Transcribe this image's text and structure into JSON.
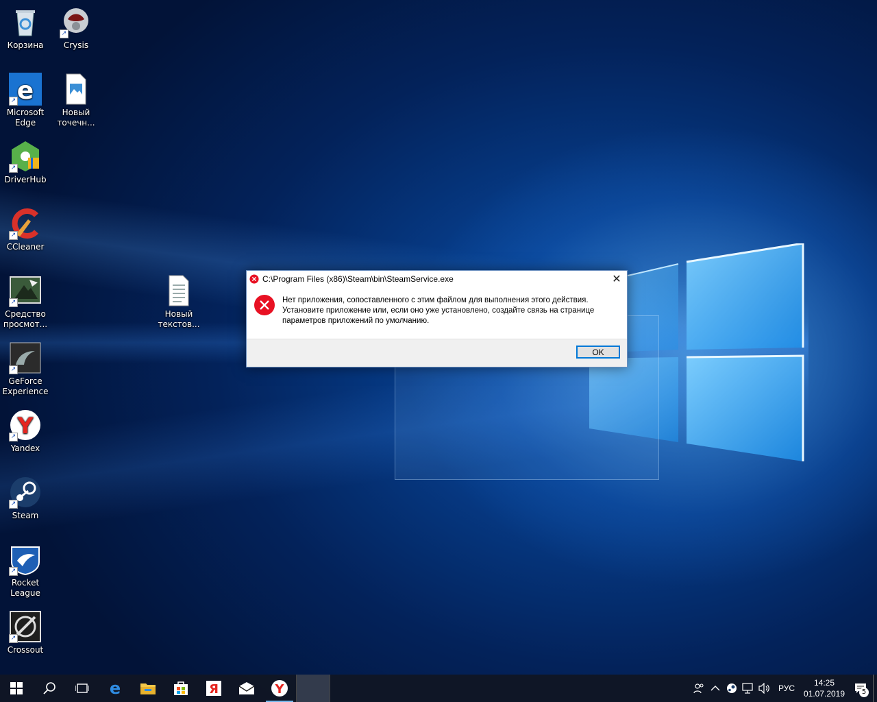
{
  "desktop": {
    "icons": [
      {
        "label": "Корзина",
        "icon": "recycle-bin-icon"
      },
      {
        "label": "Crysis",
        "icon": "crysis-icon"
      },
      {
        "label": "Microsoft Edge",
        "icon": "edge-icon"
      },
      {
        "label": "Новый точечн...",
        "icon": "bitmap-file-icon"
      },
      {
        "label": "DriverHub",
        "icon": "driverhub-icon"
      },
      {
        "label": "CCleaner",
        "icon": "ccleaner-icon"
      },
      {
        "label": "Средство просмот...",
        "icon": "image-viewer-icon"
      },
      {
        "label": "Новый текстов...",
        "icon": "text-file-icon"
      },
      {
        "label": "GeForce Experience",
        "icon": "geforce-icon"
      },
      {
        "label": "Yandex",
        "icon": "yandex-browser-icon"
      },
      {
        "label": "Steam",
        "icon": "steam-icon"
      },
      {
        "label": "Rocket League",
        "icon": "rocket-league-icon"
      },
      {
        "label": "Crossout",
        "icon": "crossout-icon"
      }
    ]
  },
  "dialog": {
    "title": "C:\\Program Files (x86)\\Steam\\bin\\SteamService.exe",
    "message_line1": "Нет приложения, сопоставленного с этим файлом для выполнения этого действия.",
    "message_line2": "Установите приложение или, если оно уже установлено, создайте связь на странице",
    "message_line3": "параметров приложений по умолчанию.",
    "ok_label": "OK",
    "close_glyph": "✕"
  },
  "taskbar": {
    "pinned": [
      "start-icon",
      "search-icon",
      "task-view-icon",
      "edge-icon",
      "file-explorer-icon",
      "store-icon",
      "yandex-icon",
      "mail-icon",
      "yandex-browser-icon"
    ],
    "tray": {
      "language": "РУС",
      "time": "14:25",
      "date": "01.07.2019",
      "notification_count": "5"
    }
  },
  "colors": {
    "accent": "#0078d7",
    "error_red": "#e81123"
  }
}
